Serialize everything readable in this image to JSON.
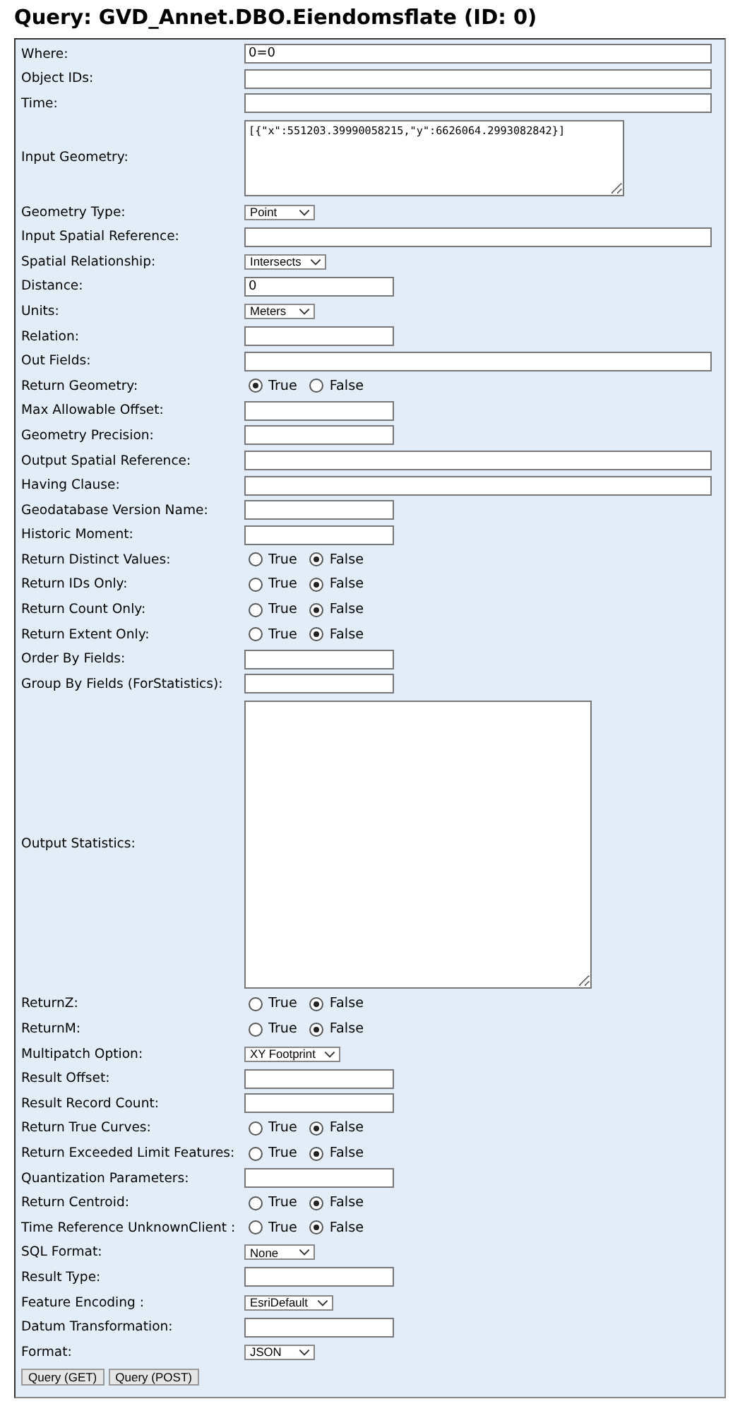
{
  "title": "Query: GVD_Annet.DBO.Eiendomsflate (ID: 0)",
  "fields": [
    {
      "label": "Where:",
      "kind": "longtext",
      "value": "0=0"
    },
    {
      "label": "Object IDs:",
      "kind": "longtext"
    },
    {
      "label": "Time:",
      "kind": "longtext"
    },
    {
      "label": "Input Geometry:",
      "kind": "textarea",
      "value": "[{\"x\":551203.39990058215,\"y\":6626064.2993082842}]"
    },
    {
      "label": "Geometry Type:",
      "kind": "select",
      "value": "Point"
    },
    {
      "label": "Input Spatial Reference:",
      "kind": "longtext"
    },
    {
      "label": "Spatial Relationship:",
      "kind": "select",
      "value": "Intersects"
    },
    {
      "label": "Distance:",
      "kind": "text",
      "value": "0"
    },
    {
      "label": "Units:",
      "kind": "select",
      "value": "Meters"
    },
    {
      "label": "Relation:",
      "kind": "text"
    },
    {
      "label": "Out Fields:",
      "kind": "longtext"
    },
    {
      "label": "Return Geometry:",
      "kind": "radio",
      "options": [
        {
          "label": "True",
          "selected": true
        },
        {
          "label": "False",
          "selected": false
        }
      ]
    },
    {
      "label": "Max Allowable Offset:",
      "kind": "text"
    },
    {
      "label": "Geometry Precision:",
      "kind": "text"
    },
    {
      "label": "Output Spatial Reference:",
      "kind": "longtext"
    },
    {
      "label": "Having Clause:",
      "kind": "longtext"
    },
    {
      "label": "Geodatabase Version Name:",
      "kind": "text"
    },
    {
      "label": "Historic Moment:",
      "kind": "text"
    },
    {
      "label": "Return Distinct Values:",
      "kind": "radio",
      "options": [
        {
          "label": "True",
          "selected": false
        },
        {
          "label": "False",
          "selected": true
        }
      ]
    },
    {
      "label": "Return IDs Only:",
      "kind": "radio",
      "options": [
        {
          "label": "True",
          "selected": false
        },
        {
          "label": "False",
          "selected": true
        }
      ]
    },
    {
      "label": "Return Count Only:",
      "kind": "radio",
      "options": [
        {
          "label": "True",
          "selected": false
        },
        {
          "label": "False",
          "selected": true
        }
      ]
    },
    {
      "label": "Return Extent Only:",
      "kind": "radio",
      "options": [
        {
          "label": "True",
          "selected": false
        },
        {
          "label": "False",
          "selected": true
        }
      ]
    },
    {
      "label": "Order By Fields:",
      "kind": "text"
    },
    {
      "label": "Group By Fields (ForStatistics):",
      "kind": "text"
    },
    {
      "label": "Output Statistics:",
      "kind": "bigtextarea"
    },
    {
      "label": "ReturnZ:",
      "kind": "radio",
      "options": [
        {
          "label": "True",
          "selected": false
        },
        {
          "label": "False",
          "selected": true
        }
      ]
    },
    {
      "label": "ReturnM:",
      "kind": "radio",
      "options": [
        {
          "label": "True",
          "selected": false
        },
        {
          "label": "False",
          "selected": true
        }
      ]
    },
    {
      "label": "Multipatch Option:",
      "kind": "select",
      "value": "XY Footprint"
    },
    {
      "label": "Result Offset:",
      "kind": "text"
    },
    {
      "label": "Result Record Count:",
      "kind": "text"
    },
    {
      "label": "Return True Curves:",
      "kind": "radio",
      "options": [
        {
          "label": "True",
          "selected": false
        },
        {
          "label": "False",
          "selected": true
        }
      ]
    },
    {
      "label": "Return Exceeded Limit Features:",
      "kind": "radio",
      "options": [
        {
          "label": "True",
          "selected": false
        },
        {
          "label": "False",
          "selected": true
        }
      ]
    },
    {
      "label": "Quantization Parameters:",
      "kind": "text"
    },
    {
      "label": "Return Centroid:",
      "kind": "radio",
      "options": [
        {
          "label": "True",
          "selected": false
        },
        {
          "label": "False",
          "selected": true
        }
      ]
    },
    {
      "label": "Time Reference UnknownClient :",
      "kind": "radio",
      "options": [
        {
          "label": "True",
          "selected": false
        },
        {
          "label": "False",
          "selected": true
        }
      ]
    },
    {
      "label": "SQL Format:",
      "kind": "select",
      "value": "None"
    },
    {
      "label": "Result Type:",
      "kind": "text"
    },
    {
      "label": "Feature Encoding :",
      "kind": "select",
      "value": "EsriDefault"
    },
    {
      "label": "Datum Transformation:",
      "kind": "text"
    },
    {
      "label": "Format:",
      "kind": "select",
      "value": "JSON"
    }
  ],
  "buttons": [
    "Query (GET)",
    "Query (POST)"
  ]
}
